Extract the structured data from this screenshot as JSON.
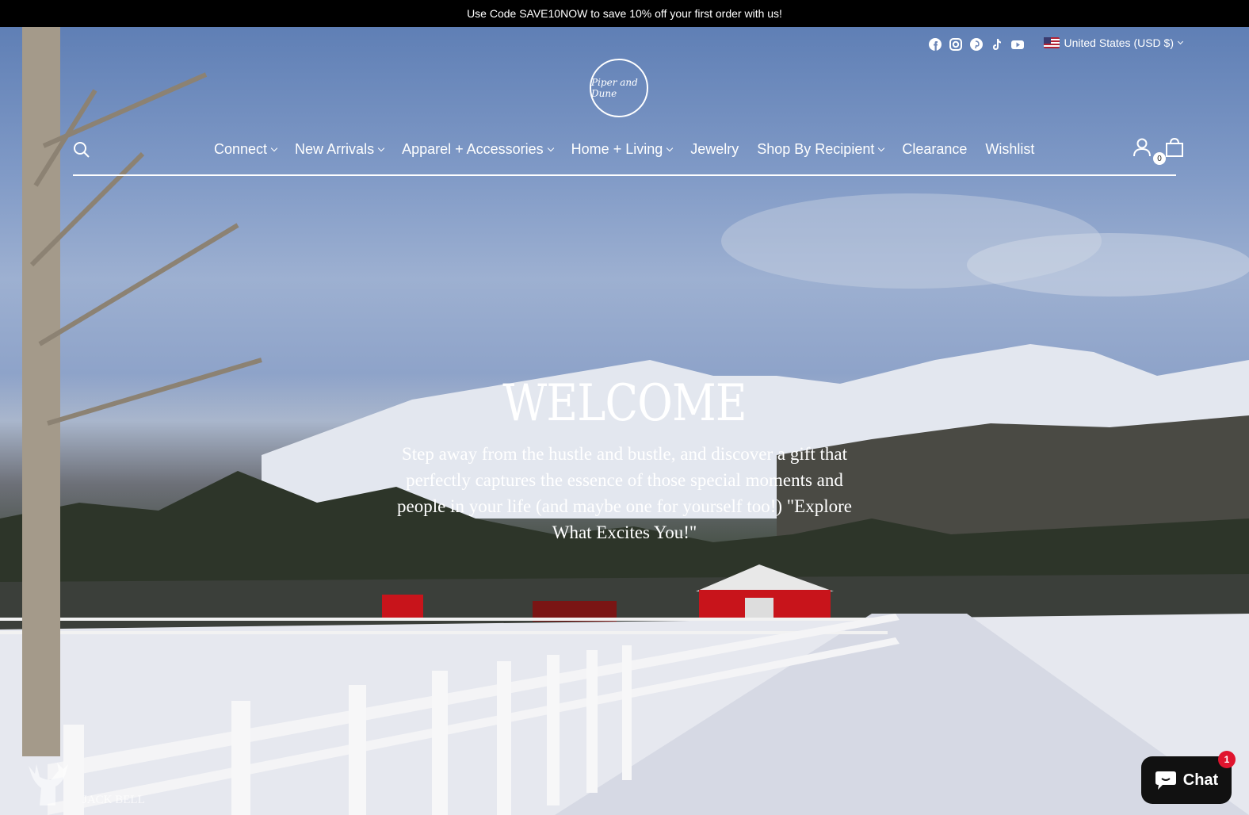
{
  "announcement": "Use Code SAVE10NOW to save 10% off your first order with us!",
  "header": {
    "social_icons": [
      "facebook-icon",
      "instagram-icon",
      "pinterest-icon",
      "tiktok-icon",
      "youtube-icon"
    ],
    "currency": "United States (USD $)",
    "logo_text": "Piper and Dune",
    "nav_items": [
      {
        "label": "Connect",
        "dropdown": true
      },
      {
        "label": "New Arrivals",
        "dropdown": true
      },
      {
        "label": "Apparel + Accessories",
        "dropdown": true
      },
      {
        "label": "Home + Living",
        "dropdown": true
      },
      {
        "label": "Jewelry",
        "dropdown": false
      },
      {
        "label": "Shop By Recipient",
        "dropdown": true
      },
      {
        "label": "Clearance",
        "dropdown": false
      },
      {
        "label": "Wishlist",
        "dropdown": false
      }
    ],
    "cart_count": "0"
  },
  "hero": {
    "title": "WELCOME",
    "body": "Step away from the hustle and bustle, and discover a gift that perfectly captures the essence of those special moments and people in your life (and maybe one for yourself too!) \"Explore What Excites You!\"",
    "watermark": "JACK BELL"
  },
  "chat": {
    "label": "Chat",
    "badge": "1"
  },
  "colors": {
    "announce_bg": "#000000",
    "chat_bg": "#111111",
    "badge": "#e0142e",
    "barn_red": "#c8141b"
  }
}
